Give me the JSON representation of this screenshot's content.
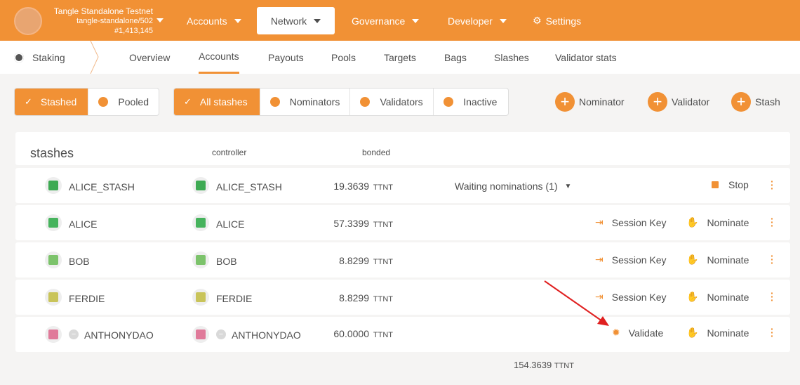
{
  "chain": {
    "name": "Tangle Standalone Testnet",
    "runtime": "tangle-standalone/502",
    "block": "#1,413,145"
  },
  "menu": {
    "accounts": "Accounts",
    "network": "Network",
    "governance": "Governance",
    "developer": "Developer",
    "settings": "Settings"
  },
  "subnav": {
    "section": "Staking",
    "tabs": [
      "Overview",
      "Accounts",
      "Payouts",
      "Pools",
      "Targets",
      "Bags",
      "Slashes",
      "Validator stats"
    ]
  },
  "filters": {
    "group1": [
      "Stashed",
      "Pooled"
    ],
    "group2": [
      "All stashes",
      "Nominators",
      "Validators",
      "Inactive"
    ]
  },
  "add_buttons": [
    "Nominator",
    "Validator",
    "Stash"
  ],
  "table": {
    "title": "stashes",
    "col_controller": "controller",
    "col_bonded": "bonded",
    "rows": [
      {
        "stash": "ALICE_STASH",
        "controller": "ALICE_STASH",
        "bonded": "19.3639",
        "unit": "TTNT",
        "status": "Waiting nominations (1)",
        "action2": "Stop"
      },
      {
        "stash": "ALICE",
        "controller": "ALICE",
        "bonded": "57.3399",
        "unit": "TTNT",
        "action1": "Session Key",
        "action2": "Nominate"
      },
      {
        "stash": "BOB",
        "controller": "BOB",
        "bonded": "8.8299",
        "unit": "TTNT",
        "action1": "Session Key",
        "action2": "Nominate"
      },
      {
        "stash": "FERDIE",
        "controller": "FERDIE",
        "bonded": "8.8299",
        "unit": "TTNT",
        "action1": "Session Key",
        "action2": "Nominate"
      },
      {
        "stash": "ANTHONYDAO",
        "controller": "ANTHONYDAO",
        "bonded": "60.0000",
        "unit": "TTNT",
        "action1": "Validate",
        "action2": "Nominate"
      }
    ],
    "total": "154.3639",
    "total_unit": "TTNT"
  },
  "colors": {
    "accent": "#f19135",
    "arrow": "#e02020"
  }
}
